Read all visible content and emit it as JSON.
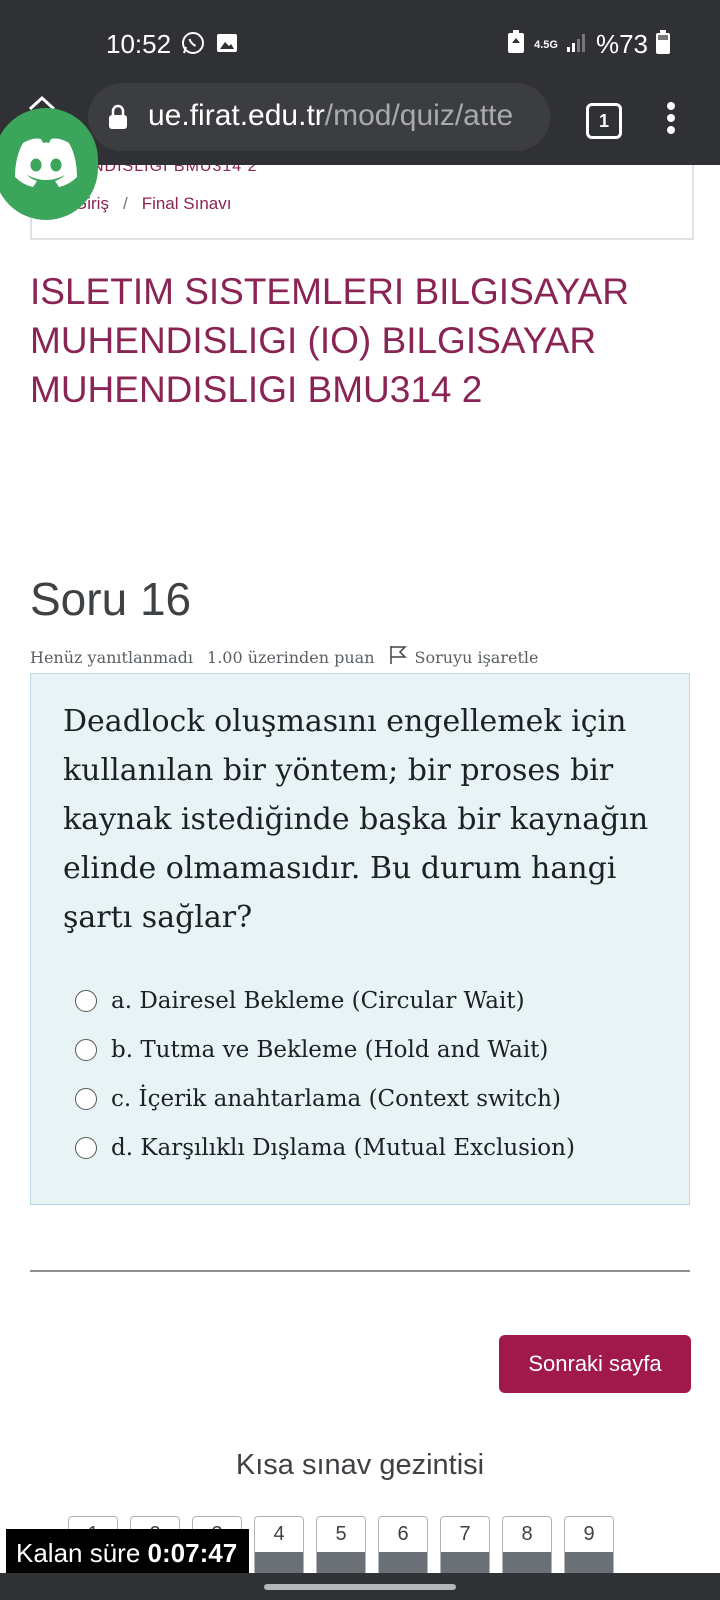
{
  "status_bar": {
    "time": "10:52",
    "network": "4.5G",
    "battery": "%73"
  },
  "browser": {
    "url_host": "ue.firat.edu.tr",
    "url_path": "/mod/quiz/atte",
    "tab_count": "1"
  },
  "breadcrumb": {
    "cut_text": "NDISLIGI BMU314 2",
    "items": [
      "Giriş",
      "Final Sınavı"
    ],
    "separator": "/"
  },
  "course_title": "ISLETIM SISTEMLERI BILGISAYAR MUHENDISLIGI (IO) BILGISAYAR MUHENDISLIGI BMU314 2",
  "question": {
    "title": "Soru 16",
    "status": "Henüz yanıtlanmadı",
    "points": "1.00 üzerinden puan",
    "flag_label": "Soruyu işaretle",
    "text": "Deadlock oluşmasını engellemek için kullanılan bir yöntem; bir proses bir kaynak istediğinde başka bir kaynağın elinde olmamasıdır. Bu durum hangi şartı sağlar?",
    "answers": [
      "a. Dairesel Bekleme (Circular Wait)",
      "b. Tutma ve Bekleme (Hold and Wait)",
      "c. İçerik anahtarlama (Context switch)",
      "d. Karşılıklı Dışlama (Mutual Exclusion)"
    ]
  },
  "next_button": "Sonraki sayfa",
  "quiz_nav": {
    "title": "Kısa sınav gezintisi",
    "buttons": [
      "1",
      "2",
      "3",
      "4",
      "5",
      "6",
      "7",
      "8",
      "9"
    ]
  },
  "timer": {
    "label": "Kalan süre",
    "value": "0:07:47"
  },
  "colors": {
    "brand": "#8a2454",
    "button": "#a1184a",
    "question_bg": "#e7f3f5",
    "discord": "#3ba55c"
  }
}
